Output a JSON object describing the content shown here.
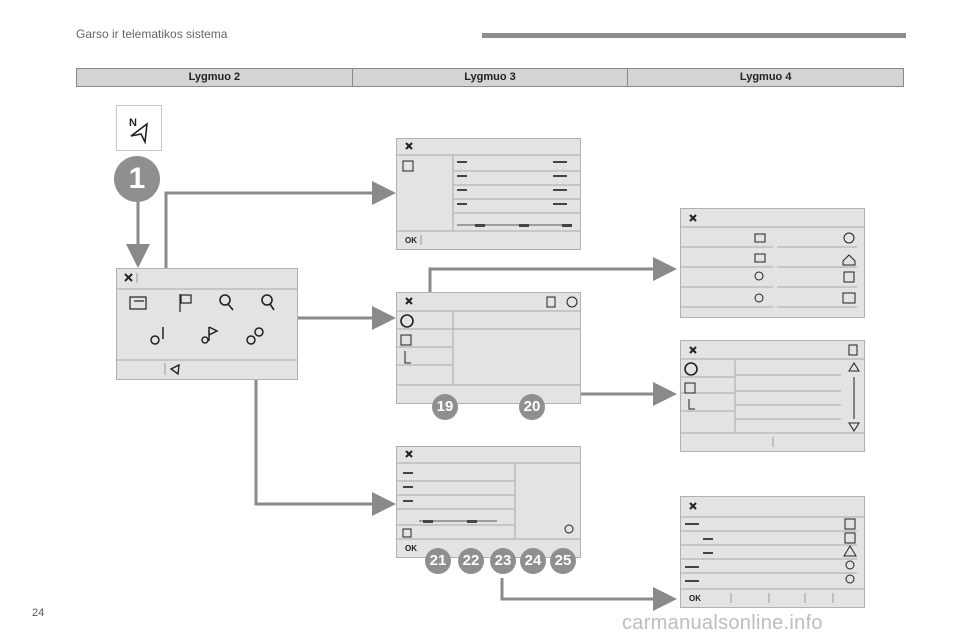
{
  "header": {
    "title": "Garso ir telematikos sistema"
  },
  "levels": [
    "Lygmuo 2",
    "Lygmuo 3",
    "Lygmuo 4"
  ],
  "start": {
    "compass_letter": "N",
    "step_number": "1"
  },
  "menu_panel": {
    "icons": [
      "close-icon",
      "list-icon",
      "flag-icon",
      "search-poi-icon",
      "search-abc-icon",
      "settings-route-icon",
      "settings-flag-icon",
      "settings-gear-icon",
      "navigation-icon"
    ]
  },
  "panels": {
    "a": {
      "ok": "OK"
    },
    "b": {
      "badges": [
        "19",
        "20"
      ]
    },
    "c": {
      "ok": "OK",
      "badges": [
        "21",
        "22",
        "23",
        "24",
        "25"
      ]
    },
    "g": {
      "ok": "OK"
    }
  },
  "footer": {
    "page_number": "24",
    "watermark": "carmanualsonline.info"
  },
  "colors": {
    "connector": "#8a8a8a",
    "panel": "#e3e3e3",
    "badge": "#8f8f8f"
  }
}
